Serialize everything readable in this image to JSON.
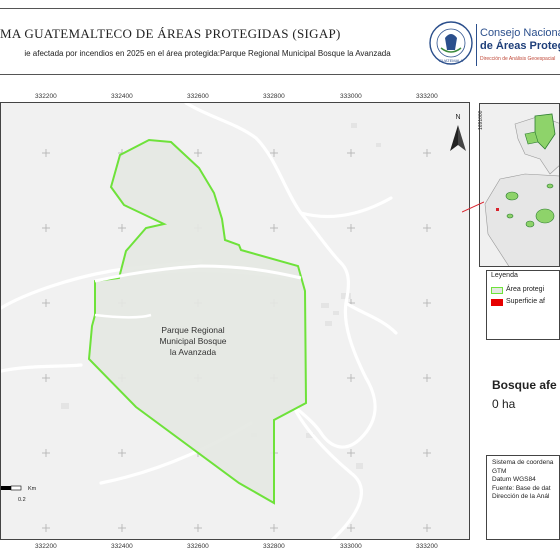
{
  "header": {
    "title": "MA GUATEMALTECO DE ÁREAS PROTEGIDAS (SIGAP)",
    "subtitle": "ie afectada por incendios en 2025 en el área protegida:Parque Regional Municipal Bosque la Avanzada",
    "logo_line1": "Consejo Nacional",
    "logo_line2": "de Áreas Protegi",
    "logo_line3": "Dirección de Análisis Geoespacial",
    "seal_text": "GUATEMALA"
  },
  "map": {
    "x_ticks": [
      "332200",
      "332400",
      "332600",
      "332800",
      "333000",
      "333200"
    ],
    "y_ticks": [
      "1691000",
      "1690800",
      "1690600",
      "1690400",
      "1690200",
      "1690000"
    ],
    "area_label": [
      "Parque Regional",
      "Municipal Bosque",
      "la Avanzada"
    ],
    "north_label": "N",
    "scale_value": "0.2",
    "scale_unit": "Km",
    "colors": {
      "protected_area_outline": "#6ee23a",
      "affected_surface": "#e60000",
      "background": "#f1f1f1",
      "roads": "#ffffff"
    }
  },
  "legend": {
    "title": "Leyenda",
    "items": [
      {
        "label": "Área protegi",
        "symbol": "green-outline"
      },
      {
        "label": "Superficie af",
        "symbol": "red-fill"
      }
    ]
  },
  "affected": {
    "title": "Bosque afe",
    "value": "0 ha"
  },
  "info": {
    "lines": [
      "Sistema de coordena",
      "GTM",
      "Datum WGS84",
      "Fuente: Base de dat",
      "Dirección de la Anál"
    ]
  }
}
